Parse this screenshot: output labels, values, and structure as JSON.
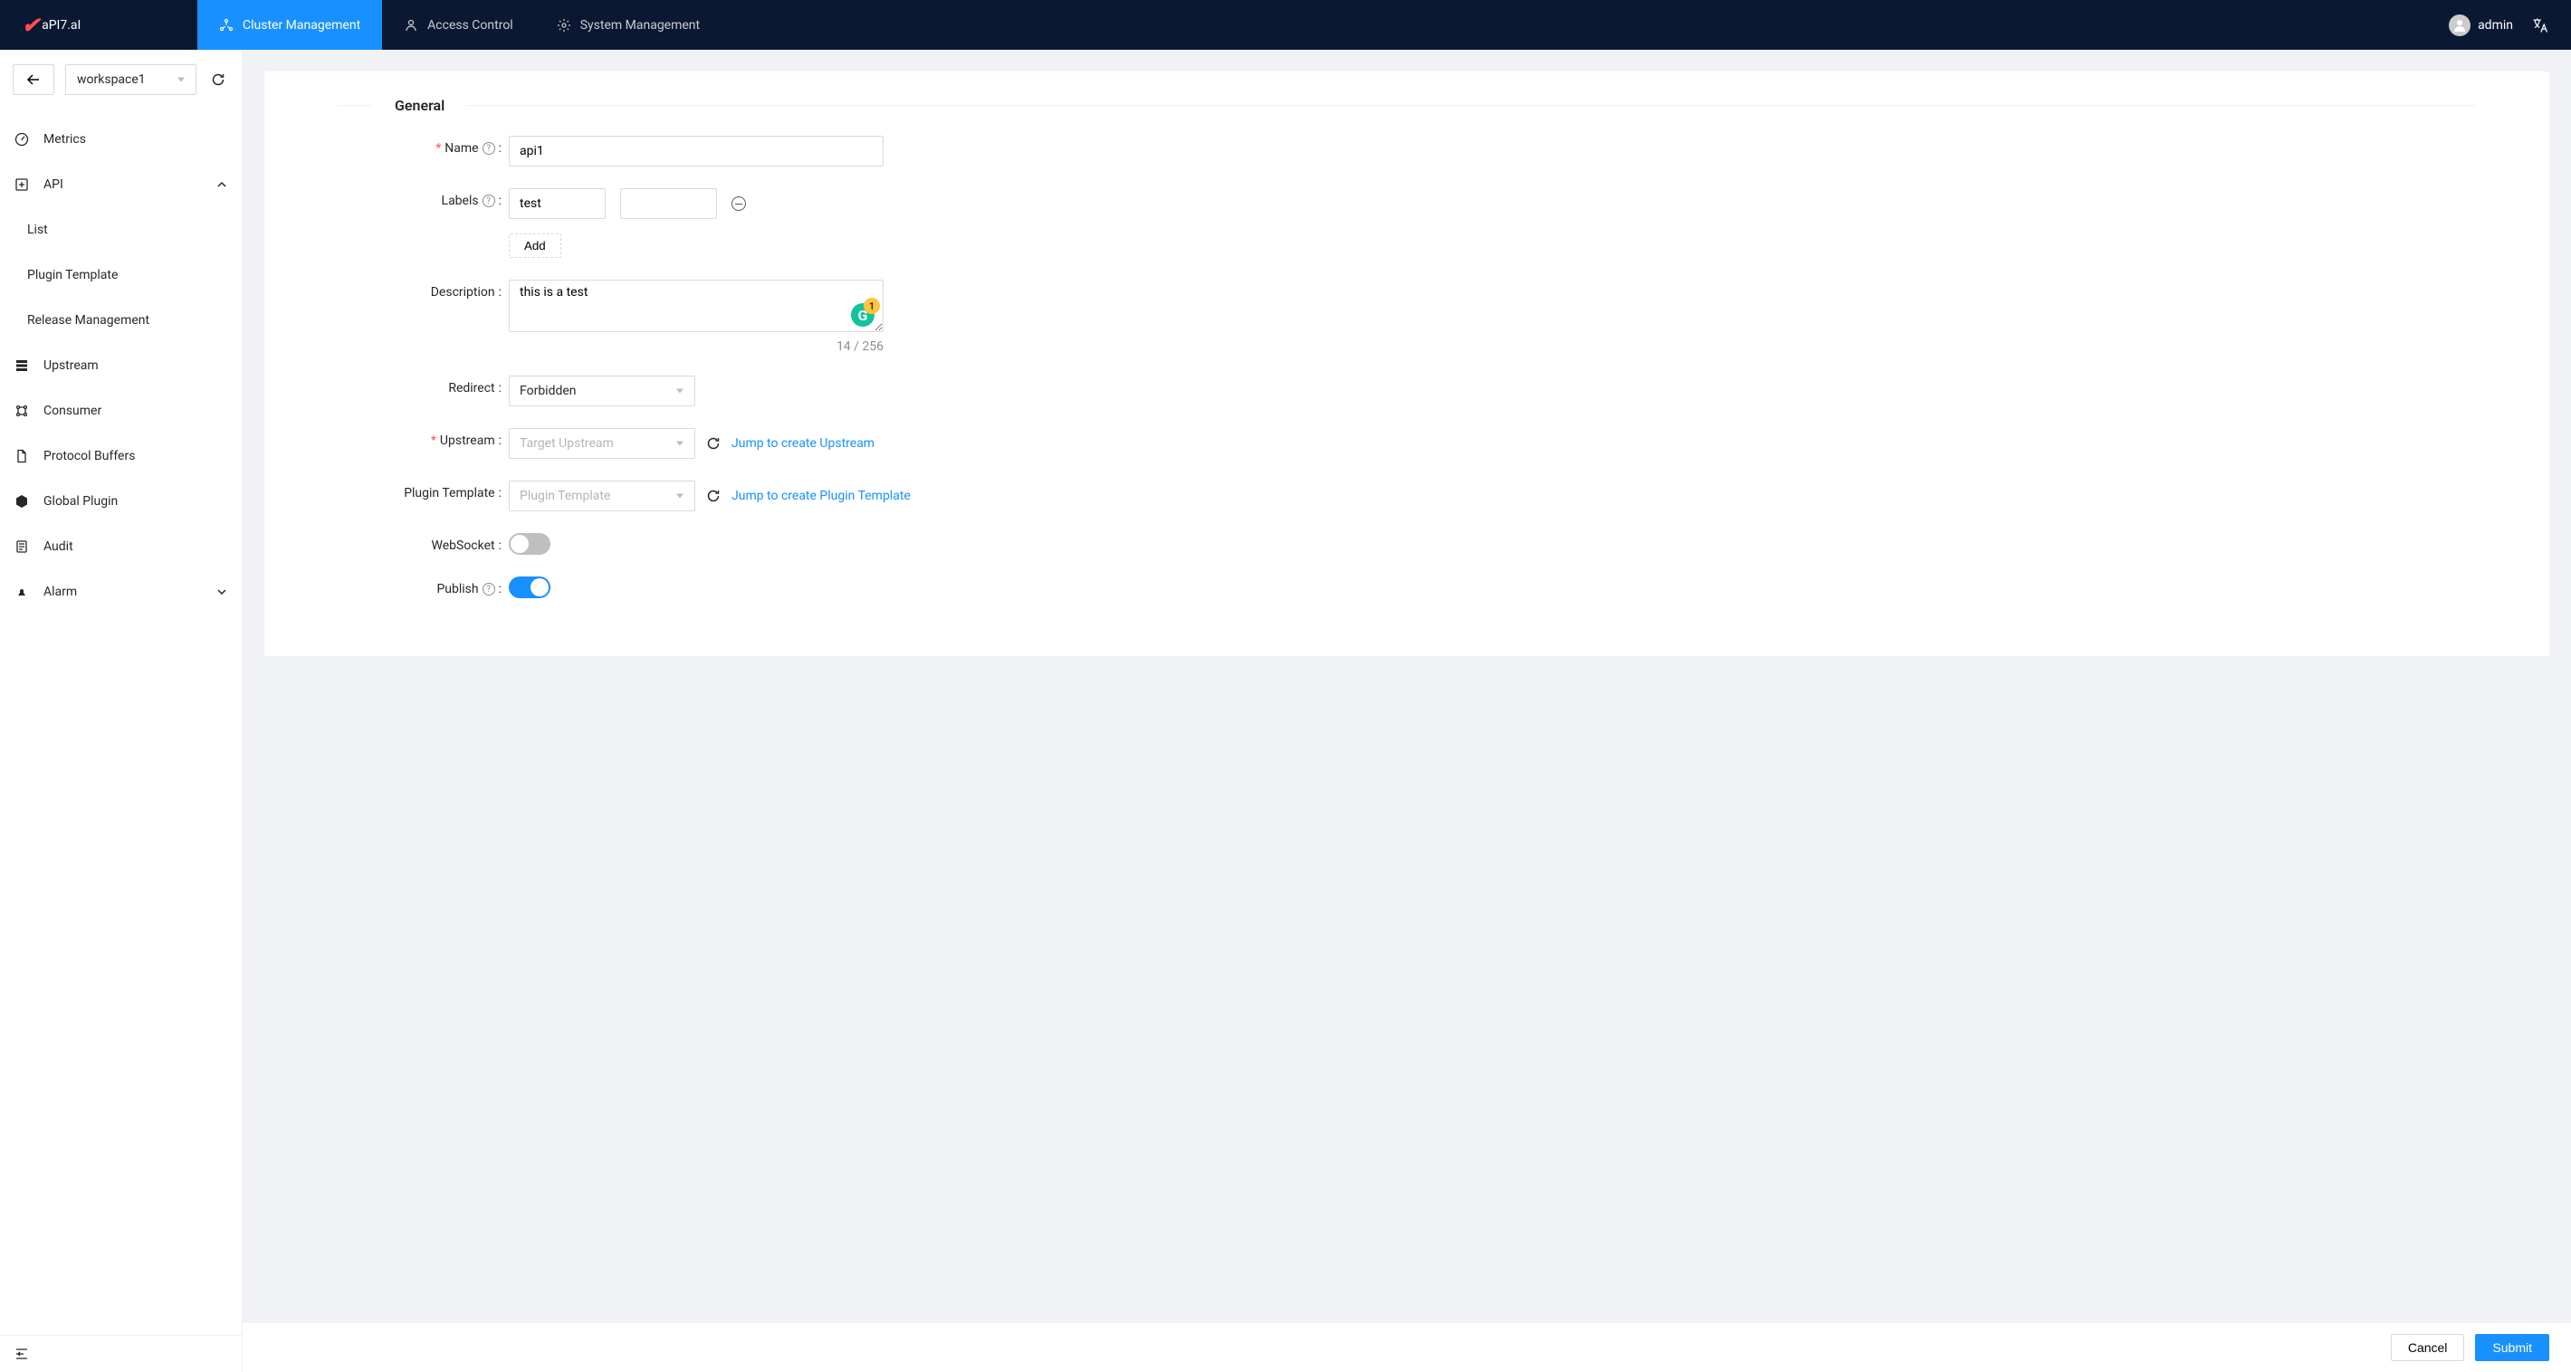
{
  "header": {
    "logo_text": "aPI7.aI",
    "nav": [
      {
        "label": "Cluster Management"
      },
      {
        "label": "Access Control"
      },
      {
        "label": "System Management"
      }
    ],
    "user": "admin"
  },
  "sidebar": {
    "workspace": "workspace1",
    "items": [
      {
        "label": "Metrics"
      },
      {
        "label": "API",
        "expanded": true,
        "children": [
          {
            "label": "List"
          },
          {
            "label": "Plugin Template"
          },
          {
            "label": "Release Management"
          }
        ]
      },
      {
        "label": "Upstream"
      },
      {
        "label": "Consumer"
      },
      {
        "label": "Protocol Buffers"
      },
      {
        "label": "Global Plugin"
      },
      {
        "label": "Audit"
      },
      {
        "label": "Alarm",
        "expanded": false
      }
    ]
  },
  "form": {
    "section_title": "General",
    "name": {
      "label": "Name",
      "value": "api1",
      "required": true
    },
    "labels": {
      "label": "Labels",
      "key": "test",
      "value": "",
      "add": "Add"
    },
    "description": {
      "label": "Description",
      "value": "this is a test",
      "counter": "14 / 256",
      "grammarly_count": "1"
    },
    "redirect": {
      "label": "Redirect",
      "value": "Forbidden"
    },
    "upstream": {
      "label": "Upstream",
      "placeholder": "Target Upstream",
      "required": true,
      "link": "Jump to create Upstream"
    },
    "plugin_template": {
      "label": "Plugin Template",
      "placeholder": "Plugin Template",
      "link": "Jump to create Plugin Template"
    },
    "websocket": {
      "label": "WebSocket",
      "on": false
    },
    "publish": {
      "label": "Publish",
      "on": true
    }
  },
  "actions": {
    "cancel": "Cancel",
    "submit": "Submit"
  }
}
